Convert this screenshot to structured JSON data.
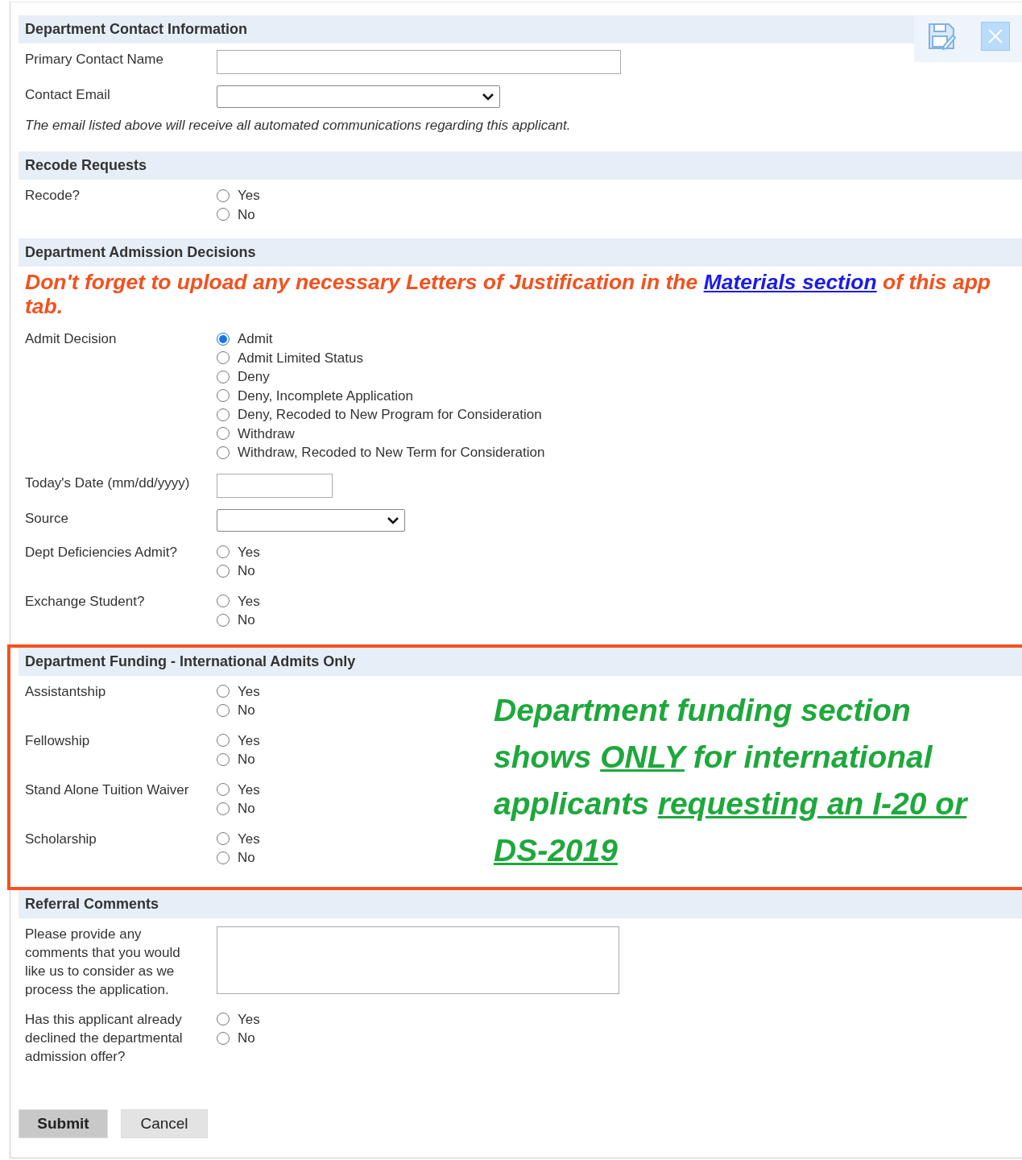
{
  "toolbar": [
    {
      "kind": "save"
    },
    {
      "kind": "close"
    }
  ],
  "sections": [
    {
      "title": "Department Contact Information",
      "highlighted": false,
      "fields": [
        {
          "kind": "text",
          "label": "Primary Contact Name"
        },
        {
          "kind": "select",
          "label": "Contact Email"
        },
        {
          "kind": "note",
          "text": "The email listed above will receive all automated communications regarding this applicant."
        }
      ]
    },
    {
      "title": "Recode Requests",
      "highlighted": false,
      "fields": [
        {
          "kind": "radio",
          "label": "Recode?",
          "options": [
            {
              "label": "Yes",
              "selected": false
            },
            {
              "label": "No",
              "selected": false
            }
          ]
        }
      ]
    },
    {
      "title": "Department Admission Decisions",
      "highlighted": false,
      "fields": [
        {
          "kind": "alert",
          "parts": [
            {
              "text": "Don't forget to upload any necessary Letters of Justification in the ",
              "link": false
            },
            {
              "text": "Materials section",
              "link": true
            },
            {
              "text": " of this app tab.",
              "link": false
            }
          ]
        },
        {
          "kind": "radio",
          "label": "Admit Decision",
          "options": [
            {
              "label": "Admit",
              "selected": true
            },
            {
              "label": "Admit Limited Status",
              "selected": false
            },
            {
              "label": "Deny",
              "selected": false
            },
            {
              "label": "Deny, Incomplete Application",
              "selected": false
            },
            {
              "label": "Deny, Recoded to New Program for Consideration",
              "selected": false
            },
            {
              "label": "Withdraw",
              "selected": false
            },
            {
              "label": "Withdraw, Recoded to New Term for Consideration",
              "selected": false
            }
          ]
        },
        {
          "kind": "date",
          "label": "Today's Date (mm/dd/yyyy)"
        },
        {
          "kind": "select",
          "label": "Source"
        },
        {
          "kind": "radio",
          "label": "Dept Deficiencies Admit?",
          "options": [
            {
              "label": "Yes",
              "selected": false
            },
            {
              "label": "No",
              "selected": false
            }
          ]
        },
        {
          "kind": "radio",
          "label": "Exchange Student?",
          "options": [
            {
              "label": "Yes",
              "selected": false
            },
            {
              "label": "No",
              "selected": false
            }
          ]
        }
      ]
    },
    {
      "title": "Department Funding - International Admits Only",
      "highlighted": true,
      "annotation": [
        {
          "text": "Department funding section shows ",
          "underline": false
        },
        {
          "text": "ONLY",
          "underline": true
        },
        {
          "text": " for international applicants ",
          "underline": false
        },
        {
          "text": "requesting an I-20 or DS-2019",
          "underline": true
        }
      ],
      "fields": [
        {
          "kind": "radio",
          "label": "Assistantship",
          "options": [
            {
              "label": "Yes",
              "selected": false
            },
            {
              "label": "No",
              "selected": false
            }
          ]
        },
        {
          "kind": "radio",
          "label": "Fellowship",
          "options": [
            {
              "label": "Yes",
              "selected": false
            },
            {
              "label": "No",
              "selected": false
            }
          ]
        },
        {
          "kind": "radio",
          "label": "Stand Alone Tuition Waiver",
          "options": [
            {
              "label": "Yes",
              "selected": false
            },
            {
              "label": "No",
              "selected": false
            }
          ]
        },
        {
          "kind": "radio",
          "label": "Scholarship",
          "options": [
            {
              "label": "Yes",
              "selected": false
            },
            {
              "label": "No",
              "selected": false
            }
          ]
        }
      ]
    },
    {
      "title": "Referral Comments",
      "highlighted": false,
      "fields": [
        {
          "kind": "textarea",
          "label": "Please provide any comments that you would like us to consider as we process the application."
        },
        {
          "kind": "radio",
          "label": "Has this applicant already declined the departmental admission offer?",
          "options": [
            {
              "label": "Yes",
              "selected": false
            },
            {
              "label": "No",
              "selected": false
            }
          ]
        }
      ]
    }
  ],
  "buttons": [
    {
      "label": "Submit",
      "primary": true
    },
    {
      "label": "Cancel",
      "primary": false
    }
  ]
}
